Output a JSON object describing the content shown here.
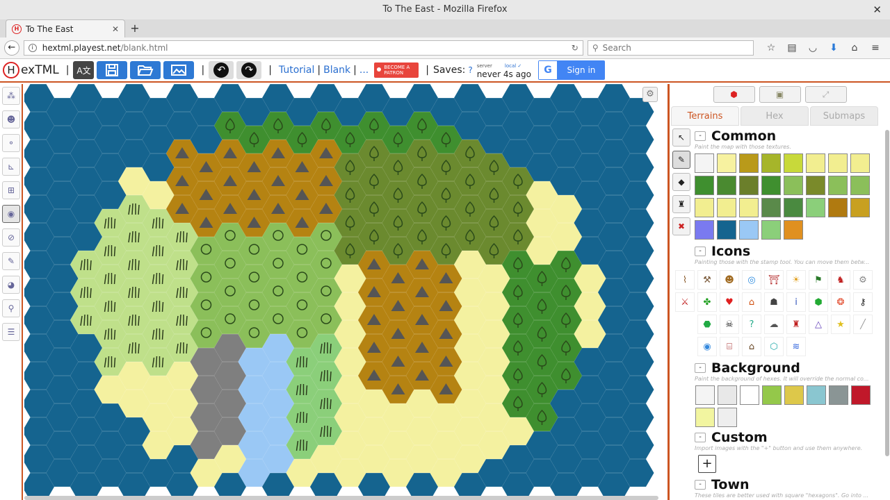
{
  "window": {
    "title": "To The East - Mozilla Firefox"
  },
  "tab": {
    "title": "To The East"
  },
  "nav": {
    "url_host": "hextml.playest.net",
    "url_path": "/blank.html",
    "search_placeholder": "Search"
  },
  "app": {
    "logo_text": "exTML",
    "logo_letter": "H",
    "tutorial": "Tutorial",
    "blank": "Blank",
    "ellipsis": "...",
    "patron": "BECOME A PATRON",
    "saves_label": "Saves:",
    "saves_q": "?",
    "server_label": "server",
    "local_label": "local ✓",
    "saved_when": "never 4s ago",
    "signin": "Sign in",
    "colors": {
      "accent": "#cc5522",
      "button_blue": "#2e79d4",
      "link": "#2a6fd0"
    }
  },
  "panel": {
    "tabs": [
      "Terrains",
      "Hex",
      "Submaps"
    ],
    "sections": {
      "common": {
        "title": "Common",
        "desc": "Paint the map with those textures."
      },
      "icons": {
        "title": "Icons",
        "desc": "Painting those with the stamp tool. You can move them betw..."
      },
      "background": {
        "title": "Background",
        "desc": "Paint the background of hexes. It will override the normal co..."
      },
      "custom": {
        "title": "Custom",
        "desc": "Import images with the \"+\" button and use them anywhere.",
        "add": "+"
      },
      "town": {
        "title": "Town",
        "desc": "These tiles are better used with square \"hexagons\". Go into ..."
      }
    },
    "common_swatches": [
      "#f4f4f4",
      "#f7f2a0",
      "#b99a1a",
      "#a6b52a",
      "#c8d93a",
      "#f2ee90",
      "#f2ee90",
      "#f2ee90",
      "#3f8f2f",
      "#4a8a30",
      "#6b7f2b",
      "#3f8f2f",
      "#8bbf5a",
      "#7a8a2a",
      "#8bbf5a",
      "#8bbf5a",
      "#f2ee90",
      "#f2ee90",
      "#f2ee90",
      "#5a8a4a",
      "#4a8a40",
      "#8bcf7a",
      "#b07a10",
      "#c8a020",
      "#7a7af0",
      "#15648f",
      "#9ac8f5",
      "#8bcf7a",
      "#e09020"
    ],
    "background_swatches": [
      "#f4f4f4",
      "#e8e8e8",
      "#ffffff",
      "#94c84a",
      "#ddc84a",
      "#8ac6d0",
      "#8a9595",
      "#c0182a",
      "#f2f5a0",
      "#eeeeee"
    ],
    "icon_names": [
      "staff-icon",
      "axe-icon",
      "monster-icon",
      "portal-icon",
      "temple-icon",
      "sun-icon",
      "banner-icon",
      "dragon-icon",
      "gear-icon",
      "sword-icon",
      "clover-icon",
      "heart-icon",
      "house-icon",
      "hood-icon",
      "info-icon",
      "gem-icon",
      "fire-icon",
      "keyhole-icon",
      "emerald-icon",
      "pirate-icon",
      "question-icon",
      "cloud-icon",
      "castle-icon",
      "wizard-icon",
      "star-icon",
      "line-icon",
      "target-icon",
      "bank-icon",
      "village-icon",
      "crystal-icon",
      "wave-icon"
    ],
    "icon_glyphs": [
      "⌇",
      "⚒",
      "☻",
      "◎",
      "⛩",
      "☀",
      "⚑",
      "♞",
      "⚙",
      "⚔",
      "✤",
      "♥",
      "⌂",
      "☗",
      "i",
      "⬢",
      "❂",
      "⚷",
      "⬣",
      "☠",
      "?",
      "☁",
      "♜",
      "△",
      "★",
      "╱",
      "◉",
      "⌸",
      "⌂",
      "⬡",
      "≋"
    ],
    "icon_colors": [
      "#8a5a2a",
      "#7a5a3a",
      "#a06a20",
      "#2a8adf",
      "#b02020",
      "#e0a020",
      "#2a7a2a",
      "#c02020",
      "#888",
      "#c02020",
      "#22a022",
      "#e02020",
      "#d05010",
      "#444",
      "#3355bb",
      "#22aa33",
      "#e04020",
      "#222",
      "#22aa44",
      "#222",
      "#22aa88",
      "#555",
      "#c02020",
      "#6644bb",
      "#e0c020",
      "#999",
      "#3388dd",
      "#a02020",
      "#664422",
      "#22aaaa",
      "#3366dd"
    ]
  }
}
